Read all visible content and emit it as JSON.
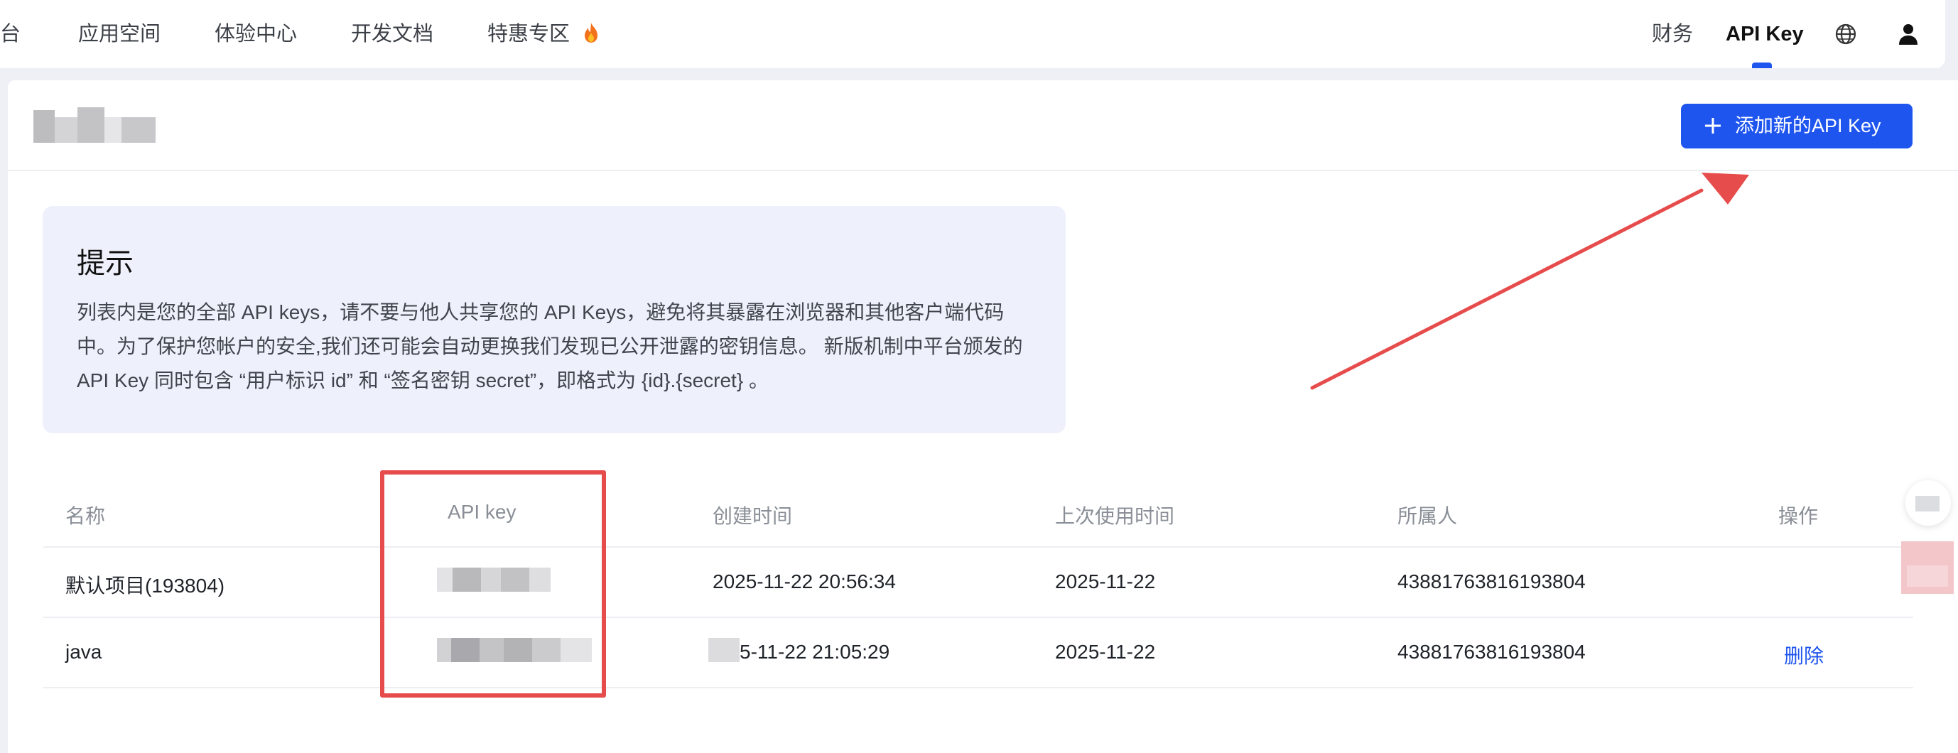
{
  "nav": {
    "left_items": [
      "台",
      "应用空间",
      "体验中心",
      "开发文档",
      "特惠专区"
    ],
    "right_items": {
      "finance": "财务",
      "api_key": "API Key"
    },
    "icons": {
      "hot": "fire-icon",
      "language": "globe-icon",
      "user": "user-icon"
    }
  },
  "header": {
    "add_button": "添加新的API Key"
  },
  "tip": {
    "title": "提示",
    "lines": [
      "列表内是您的全部 API keys，请不要与他人共享您的 API Keys，避免将其暴露在浏览器和其他客户端代码",
      "中。为了保护您帐户的安全,我们还可能会自动更换我们发现已公开泄露的密钥信息。 新版机制中平台颁发的",
      "API Key 同时包含 “用户标识 id” 和 “签名密钥 secret”，即格式为 {id}.{secret} 。"
    ]
  },
  "table": {
    "columns": [
      "名称",
      "API key",
      "创建时间",
      "上次使用时间",
      "所属人",
      "操作"
    ],
    "rows": [
      {
        "name": "默认项目(193804)",
        "created": "2025-11-22 20:56:34",
        "last_used": "2025-11-22",
        "owner": "43881763816193804",
        "action": ""
      },
      {
        "name": "java",
        "created": "5-11-22 21:05:29",
        "last_used": "2025-11-22",
        "owner": "43881763816193804",
        "action": "删除"
      }
    ]
  },
  "colors": {
    "primary": "#1f55ef",
    "annotation": "#e74c4c"
  }
}
